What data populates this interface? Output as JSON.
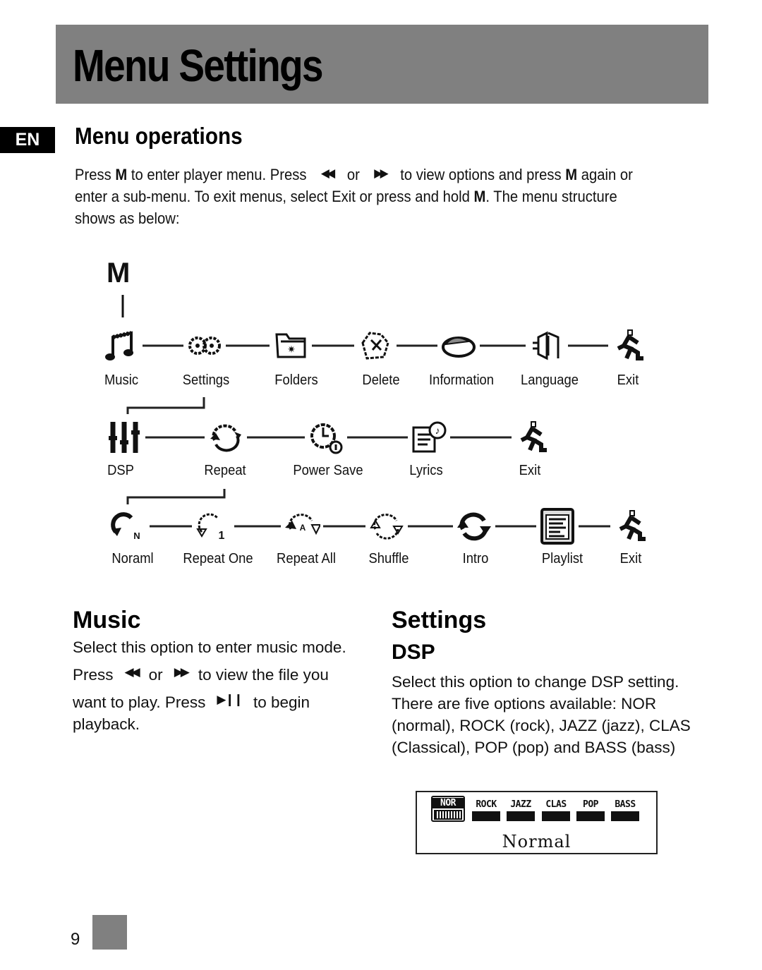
{
  "header": {
    "title": "Menu Settings",
    "language_badge": "EN"
  },
  "menu_operations": {
    "title": "Menu operations",
    "paragraph": {
      "p1": "Press ",
      "key_m": "M",
      "p2": " to enter player menu. Press ",
      "prev_icon": "◀◀",
      "p3": " or ",
      "next_icon": "▶▶",
      "p4": " to view options and press ",
      "key_m2": "M",
      "p5": " again or enter a sub-menu. To exit menus, select Exit or press and hold ",
      "key_m3": "M",
      "p6": ". The menu structure shows as below:"
    }
  },
  "diagram": {
    "root_label": "M",
    "main_menu": [
      {
        "label": "Music",
        "icon": "music-note-icon"
      },
      {
        "label": "Settings",
        "icon": "gears-icon"
      },
      {
        "label": "Folders",
        "icon": "folder-icon"
      },
      {
        "label": "Delete",
        "icon": "delete-icon"
      },
      {
        "label": "Information",
        "icon": "information-disc-icon"
      },
      {
        "label": "Language",
        "icon": "language-icon"
      },
      {
        "label": "Exit",
        "icon": "running-man-exit-icon"
      }
    ],
    "settings_menu": [
      {
        "label": "DSP",
        "icon": "equalizer-sliders-icon"
      },
      {
        "label": "Repeat",
        "icon": "repeat-icon"
      },
      {
        "label": "Power Save",
        "icon": "power-save-clock-icon"
      },
      {
        "label": "Lyrics",
        "icon": "lyrics-icon"
      },
      {
        "label": "Exit",
        "icon": "running-man-exit-icon"
      }
    ],
    "repeat_menu": [
      {
        "label": "Noraml",
        "icon": "normal-mode-icon"
      },
      {
        "label": "Repeat One",
        "icon": "repeat-one-icon"
      },
      {
        "label": "Repeat All",
        "icon": "repeat-all-icon"
      },
      {
        "label": "Shuffle",
        "icon": "shuffle-icon"
      },
      {
        "label": "Intro",
        "icon": "intro-icon"
      },
      {
        "label": "Playlist",
        "icon": "playlist-icon"
      },
      {
        "label": "Exit",
        "icon": "running-man-exit-icon"
      }
    ]
  },
  "music_section": {
    "title": "Music",
    "line1": "Select this option to enter music mode.",
    "line2_a": "Press",
    "prev_icon": "◀◀",
    "line2_b": "or",
    "next_icon": "▶▶",
    "line2_c": "to view the file you",
    "line3_a": "want to play. Press",
    "play_pause_icon": "▶❙❙",
    "line3_b": "to begin",
    "line4": "playback."
  },
  "settings_section": {
    "title": "Settings",
    "subtitle": "DSP",
    "paragraph": "Select this option to change DSP setting. There are five options available: NOR (normal), ROCK (rock), JAZZ (jazz), CLAS (Classical), POP (pop) and BASS (bass)"
  },
  "lcd": {
    "options": [
      "NOR",
      "ROCK",
      "JAZZ",
      "CLAS",
      "POP",
      "BASS"
    ],
    "selected": "NOR",
    "mode_text": "Normal"
  },
  "footer": {
    "page_number": "9"
  }
}
